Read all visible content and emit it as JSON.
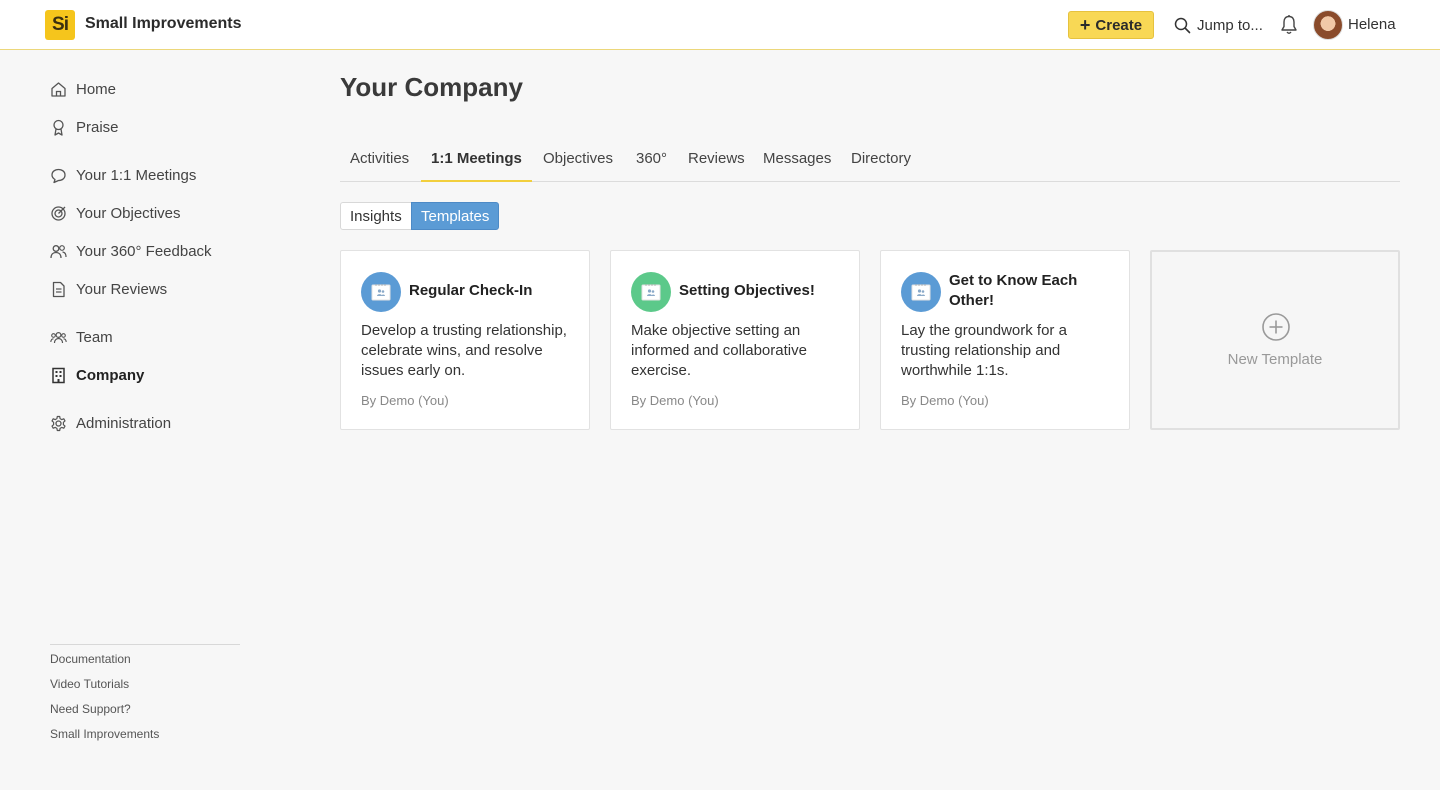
{
  "app": {
    "logo_text": "Si",
    "name": "Small Improvements"
  },
  "topbar": {
    "create_label": "Create",
    "jump_label": "Jump to...",
    "user_name": "Helena"
  },
  "sidebar": {
    "items": [
      {
        "label": "Home",
        "icon": "home-icon"
      },
      {
        "label": "Praise",
        "icon": "award-icon"
      },
      {
        "label": "Your 1:1 Meetings",
        "icon": "chat-icon"
      },
      {
        "label": "Your Objectives",
        "icon": "target-icon"
      },
      {
        "label": "Your 360° Feedback",
        "icon": "people-icon"
      },
      {
        "label": "Your Reviews",
        "icon": "document-icon"
      },
      {
        "label": "Team",
        "icon": "team-icon"
      },
      {
        "label": "Company",
        "icon": "building-icon",
        "active": true
      },
      {
        "label": "Administration",
        "icon": "gear-icon"
      }
    ],
    "footer_links": [
      "Documentation",
      "Video Tutorials",
      "Need Support?",
      "Small Improvements"
    ]
  },
  "main": {
    "title": "Your Company",
    "tabs": [
      "Activities",
      "1:1 Meetings",
      "Objectives",
      "360°",
      "Reviews",
      "Messages",
      "Directory"
    ],
    "active_tab": "1:1 Meetings",
    "subtabs": [
      "Insights",
      "Templates"
    ],
    "active_subtab": "Templates",
    "cards": [
      {
        "title": "Regular Check-In",
        "description": "Develop a trusting relationship, celebrate wins, and resolve issues early on.",
        "author": "By Demo (You)",
        "icon_color": "#5b9bd5"
      },
      {
        "title": "Setting Objectives!",
        "description": "Make objective setting an informed and collaborative exercise.",
        "author": "By Demo (You)",
        "icon_color": "#5cc98a"
      },
      {
        "title": "Get to Know Each Other!",
        "description": "Lay the groundwork for a trusting relationship and worthwhile 1:1s.",
        "author": "By Demo (You)",
        "icon_color": "#5b9bd5"
      }
    ],
    "new_template_label": "New Template"
  },
  "colors": {
    "accent": "#f8d855",
    "blue": "#5b9bd5",
    "green": "#5cc98a"
  }
}
